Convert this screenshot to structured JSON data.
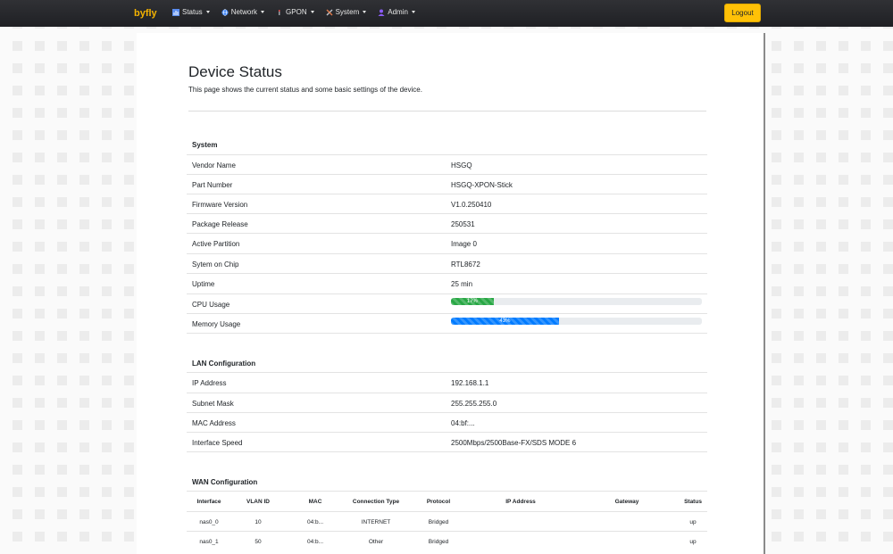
{
  "nav": {
    "brand": "byfly",
    "menu": [
      {
        "label": "Status",
        "icon": "chart-icon"
      },
      {
        "label": "Network",
        "icon": "globe-icon"
      },
      {
        "label": "GPON",
        "icon": "signal-icon"
      },
      {
        "label": "System",
        "icon": "tools-icon"
      },
      {
        "label": "Admin",
        "icon": "user-icon"
      }
    ],
    "logout_label": "Logout"
  },
  "page": {
    "title": "Device Status",
    "subtitle": "This page shows the current status and some basic settings of the device."
  },
  "system": {
    "title": "System",
    "rows": [
      {
        "label": "Vendor Name",
        "value": "HSGQ"
      },
      {
        "label": "Part Number",
        "value": "HSGQ-XPON-Stick"
      },
      {
        "label": "Firmware Version",
        "value": "V1.0.250410"
      },
      {
        "label": "Package Release",
        "value": "250531"
      },
      {
        "label": "Active Partition",
        "value": "Image 0"
      },
      {
        "label": "Sytem on Chip",
        "value": "RTL8672"
      },
      {
        "label": "Uptime",
        "value": "25 min"
      }
    ],
    "cpu": {
      "label": "CPU Usage",
      "value": 17,
      "text": "17%"
    },
    "memory": {
      "label": "Memory Usage",
      "value": 43,
      "text": "43%"
    }
  },
  "lan": {
    "title": "LAN Configuration",
    "rows": [
      {
        "label": "IP Address",
        "value": "192.168.1.1"
      },
      {
        "label": "Subnet Mask",
        "value": "255.255.255.0"
      },
      {
        "label": "MAC Address",
        "value": "04:bf:..."
      },
      {
        "label": "Interface Speed",
        "value": "2500Mbps/2500Base-FX/SDS MODE 6"
      }
    ]
  },
  "wan": {
    "title": "WAN Configuration",
    "headers": [
      "Interface",
      "VLAN ID",
      "MAC",
      "Connection Type",
      "Protocol",
      "IP Address",
      "Gateway",
      "Status"
    ],
    "rows": [
      [
        "nas0_0",
        "10",
        "04:b...",
        "INTERNET",
        "Bridged",
        "",
        "",
        "up"
      ],
      [
        "nas0_1",
        "50",
        "04:b...",
        "Other",
        "Bridged",
        "",
        "",
        "up"
      ]
    ]
  },
  "colors": {
    "accent": "#ffc107",
    "brand": "#f5b301",
    "cpu_bar": "#28a745",
    "mem_bar": "#007bff"
  }
}
